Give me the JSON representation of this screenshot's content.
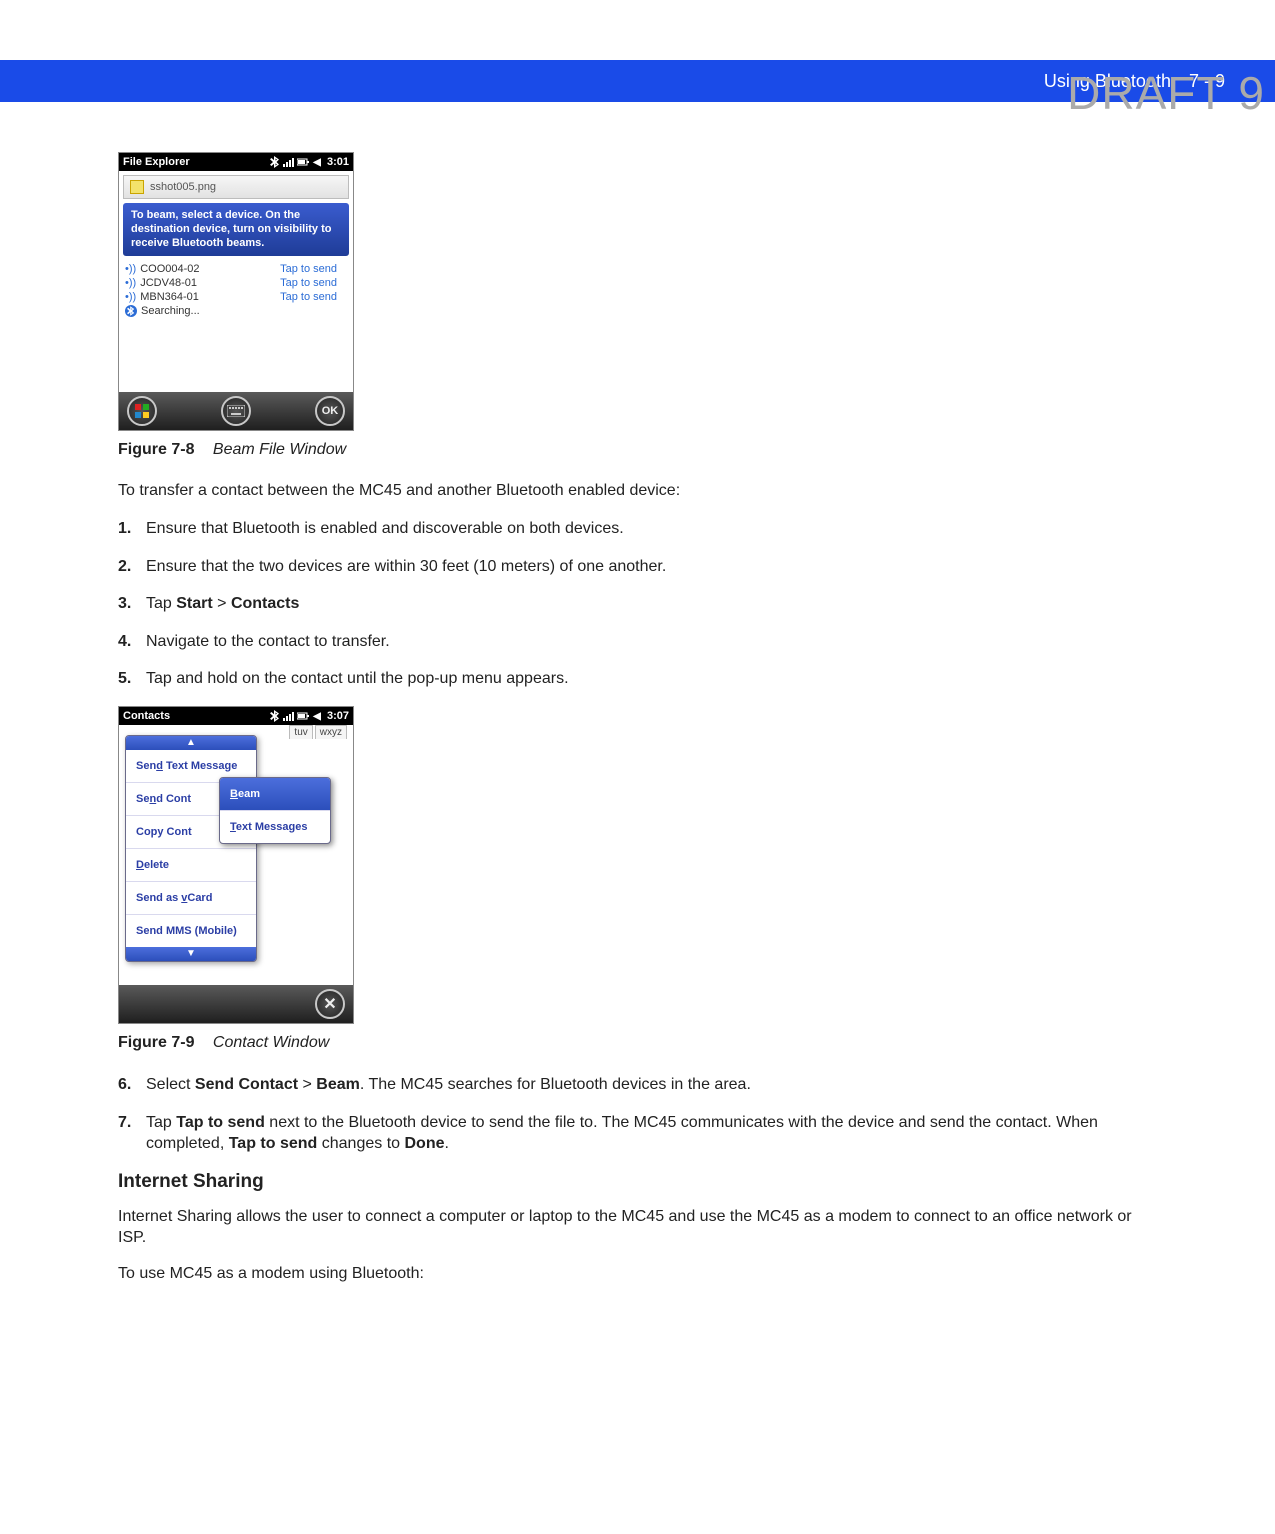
{
  "watermark": "DRAFT 9",
  "header": {
    "section": "Using Bluetooth",
    "page": "7 - 9"
  },
  "device1": {
    "titlebar_app": "File Explorer",
    "titlebar_time": "3:01",
    "file_name": "sshot005.png",
    "message": "To beam, select a device. On the destination device, turn on visibility to receive Bluetooth beams.",
    "rows": [
      {
        "name": "COO004-02",
        "action": "Tap to send"
      },
      {
        "name": "JCDV48-01",
        "action": "Tap to send"
      },
      {
        "name": "MBN364-01",
        "action": "Tap to send"
      }
    ],
    "searching": "Searching...",
    "ok_label": "OK"
  },
  "fig78": {
    "id": "Figure 7-8",
    "title": "Beam File Window"
  },
  "intro_para": "To transfer a contact between the MC45 and another Bluetooth enabled device:",
  "steps_a": {
    "s1": "Ensure that Bluetooth is enabled and discoverable on both devices.",
    "s2": "Ensure that the two devices are within 30 feet (10 meters) of one another.",
    "s3_pre": "Tap ",
    "s3_b1": "Start",
    "s3_mid": " > ",
    "s3_b2": "Contacts",
    "s4": "Navigate to the contact to transfer.",
    "s5": "Tap and hold on the contact until the pop-up menu appears."
  },
  "device2": {
    "titlebar_app": "Contacts",
    "titlebar_time": "3:07",
    "tabs": [
      "tuv",
      "wxyz"
    ],
    "menu": {
      "arrow_up": "▲",
      "arrow_down": "▼",
      "item1_pre": "Sen",
      "item1_u": "d",
      "item1_post": " Text Message",
      "item2_pre": "Se",
      "item2_u": "n",
      "item2_post": "d Cont",
      "item3_text": "Copy Cont",
      "item4_u": "D",
      "item4_post": "elete",
      "item5_pre": "Send as ",
      "item5_u": "v",
      "item5_post": "Card",
      "item6": "Send MMS (Mobile)"
    },
    "submenu": {
      "item1_u": "B",
      "item1_post": "eam",
      "item2_u": "T",
      "item2_post": "ext Messages"
    }
  },
  "fig79": {
    "id": "Figure 7-9",
    "title": "Contact Window"
  },
  "steps_b": {
    "s6_pre": "Select ",
    "s6_b1": "Send Contact",
    "s6_mid1": " > ",
    "s6_b2": "Beam",
    "s6_post": ". The MC45 searches for Bluetooth devices in the area.",
    "s7_pre": "Tap ",
    "s7_b1": "Tap to send",
    "s7_mid": " next to the Bluetooth device to send the file to. The MC45 communicates with the device and send the contact. When completed, ",
    "s7_b2": "Tap to send",
    "s7_mid2": " changes to ",
    "s7_b3": "Done",
    "s7_post": "."
  },
  "section_heading": "Internet Sharing",
  "section_para": "Internet Sharing allows the user to connect a computer or laptop to the MC45 and use the MC45 as a modem to connect to an office network or ISP.",
  "section_para2": "To use MC45 as a modem using Bluetooth:"
}
